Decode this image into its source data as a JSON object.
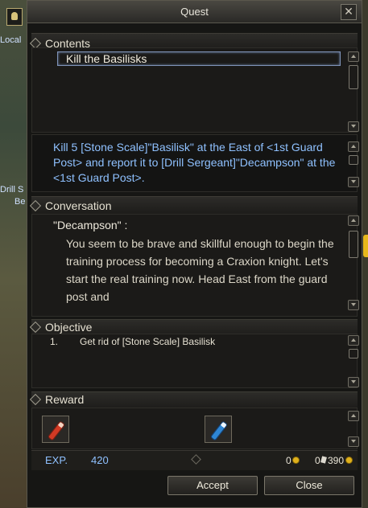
{
  "background": {
    "labels": [
      "Local",
      "Drill S",
      "Be"
    ]
  },
  "window": {
    "title": "Quest",
    "close_glyph": "✕"
  },
  "sections": {
    "contents": "Contents",
    "conversation": "Conversation",
    "objective": "Objective",
    "reward": "Reward"
  },
  "contents": {
    "selected_quest": "Kill the Basilisks"
  },
  "description": "Kill 5 [Stone Scale]\"Basilisk\" at the East of <1st Guard Post> and report it to [Drill Sergeant]\"Decampson\" at the <1st Guard Post>.",
  "conversation": {
    "speaker": "\"Decampson\" :",
    "text": "You seem to be brave and skillful enough to begin the training process for becoming a Craxion knight. Let's start the real training now. Head East from the guard post and"
  },
  "objective": {
    "items": [
      {
        "number": "1.",
        "text": "Get rid of [Stone Scale] Basilisk"
      }
    ]
  },
  "reward": {
    "items": [
      {
        "icon": "red-potion-icon"
      },
      {
        "icon": "blue-potion-icon"
      }
    ],
    "exp_label": "EXP.",
    "exp_value": "420",
    "coin_a": "0",
    "coin_b": "0",
    "coin_c": "390"
  },
  "buttons": {
    "accept": "Accept",
    "close": "Close"
  },
  "colors": {
    "quest_text": "#8fc1ff",
    "window_bg": "#161614",
    "gold": "#e0b11c"
  }
}
